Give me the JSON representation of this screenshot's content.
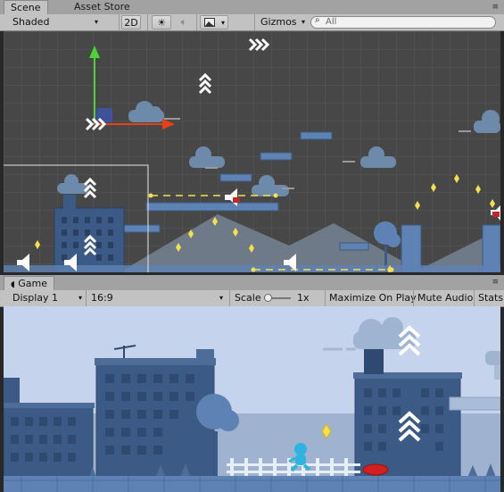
{
  "scene_panel": {
    "tabs": [
      {
        "label": "Scene",
        "active": true
      },
      {
        "label": "Asset Store",
        "active": false
      }
    ],
    "window_controls": "≡",
    "toolbar": {
      "shading_mode": "Shaded",
      "mode_2d": "2D",
      "light_icon": "sun-icon",
      "audio_icon": "speaker-icon",
      "effects_icon": "image-icon",
      "gizmos_label": "Gizmos",
      "search_placeholder": "All"
    }
  },
  "game_panel": {
    "tab": {
      "label": "Game",
      "icon": "pacman-icon"
    },
    "window_controls": "≡",
    "toolbar": {
      "display": "Display 1",
      "aspect": "16:9",
      "scale_label": "Scale",
      "scale_value": "1x",
      "scale_fraction": 0.0,
      "maximize_on_play": "Maximize On Play",
      "mute_audio": "Mute Audio",
      "stats": "Stats"
    }
  },
  "colors": {
    "panel_bg": "#c2c2c2",
    "tab_bar_bg": "#a2a2a2",
    "scene_bg": "#474747",
    "game_sky": "#c5d3ec",
    "building": "#3c5a86",
    "building_dark": "#2e4a70",
    "platform": "#5e82b4",
    "gizmo_y": "#4cd137",
    "gizmo_x": "#e84118",
    "coin": "#f5e04a",
    "player": "#2fb4e0",
    "enemy": "#d02020"
  }
}
